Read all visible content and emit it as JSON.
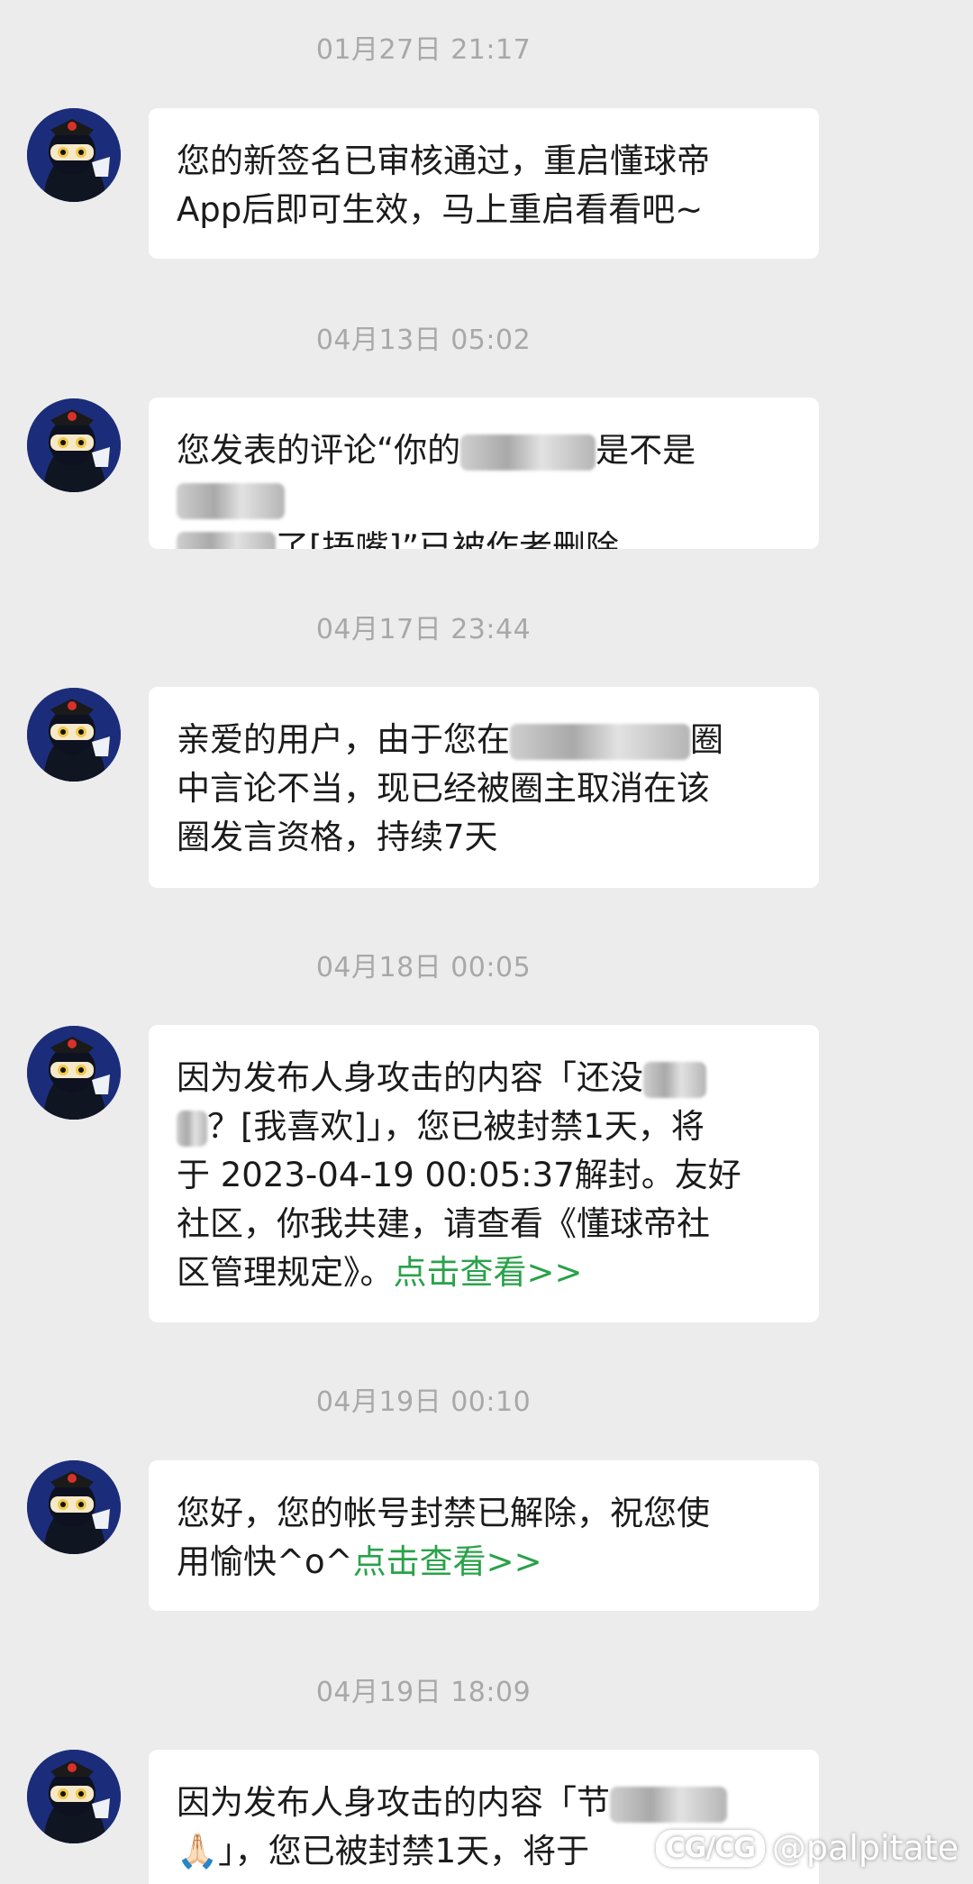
{
  "messages": [
    {
      "time": "01月27日 21:17",
      "line1": "您的新签名已审核通过，重启懂球帝",
      "line2": "App后即可生效，马上重启看看吧~"
    },
    {
      "time": "04月13日 05:02",
      "line1a": "您发表的评论“你的",
      "line1b": "是不是",
      "line2b": "了[捂嘴]”已被作者删除"
    },
    {
      "time": "04月17日 23:44",
      "line1a": "亲爱的用户，由于您在",
      "line1b": "圈",
      "line2": "中言论不当，现已经被圈主取消在该",
      "line3": "圈发言资格，持续7天"
    },
    {
      "time": "04月18日 00:05",
      "line1a": "因为发布人身攻击的内容「还没",
      "line2b": "？[我喜欢]」，您已被封禁1天，将",
      "line3": "于 2023-04-19 00:05:37解封。友好",
      "line4": "社区，你我共建，请查看《懂球帝社",
      "line5a": "区管理规定》。",
      "link": "点击查看>>"
    },
    {
      "time": "04月19日 00:10",
      "line1": "您好，您的帐号封禁已解除，祝您使",
      "line2a": "用愉快^o^",
      "link": "点击查看>>"
    },
    {
      "time": "04月19日 18:09",
      "line1a": "因为发布人身攻击的内容「节",
      "line2a": "🙏🏻",
      "line2b": "」，您已被封禁1天，将于"
    }
  ],
  "watermark": {
    "logo": "CG/CG",
    "handle": "@palpitate"
  }
}
